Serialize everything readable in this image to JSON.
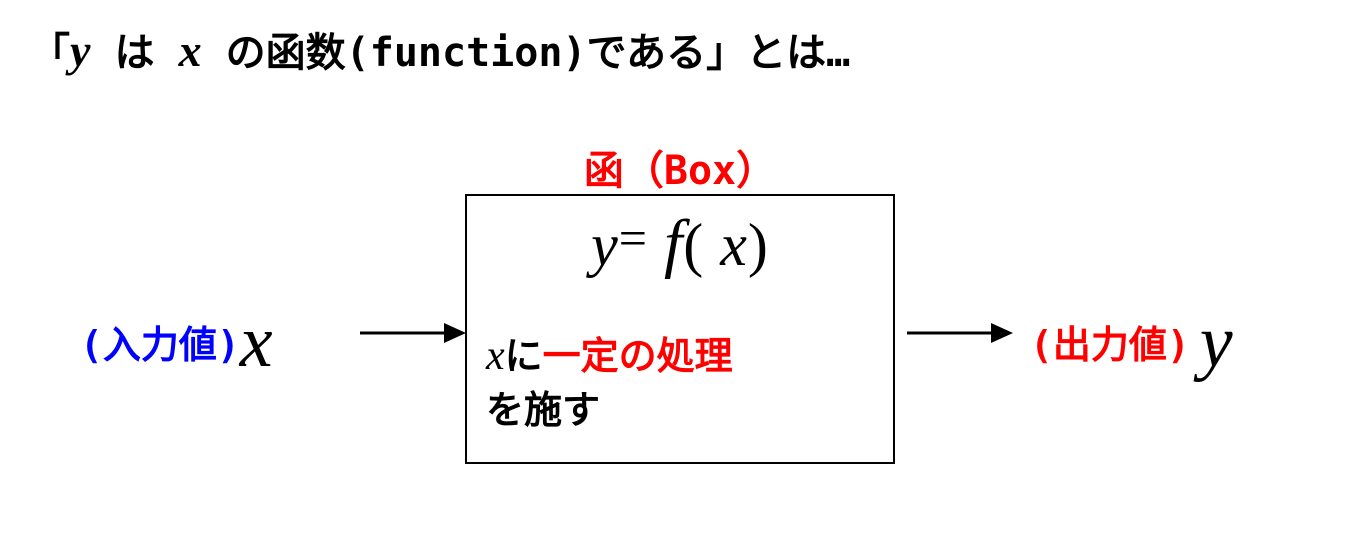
{
  "title": {
    "open_bracket": "「",
    "y": "y",
    "mid1": " は ",
    "x": "x",
    "mid2": " の函数(function)である」とは…"
  },
  "box_title": "函（Box）",
  "equation": {
    "y": "y",
    "eq": "=",
    "f": "f",
    "open": "(",
    "x": "x",
    "close": ")"
  },
  "description": {
    "x": "x",
    "ni": "に",
    "process": "一定の処理",
    "apply": "を施す"
  },
  "input": {
    "label": "(入力値)",
    "var": "x"
  },
  "output": {
    "label": "(出力値)",
    "var": "y"
  }
}
